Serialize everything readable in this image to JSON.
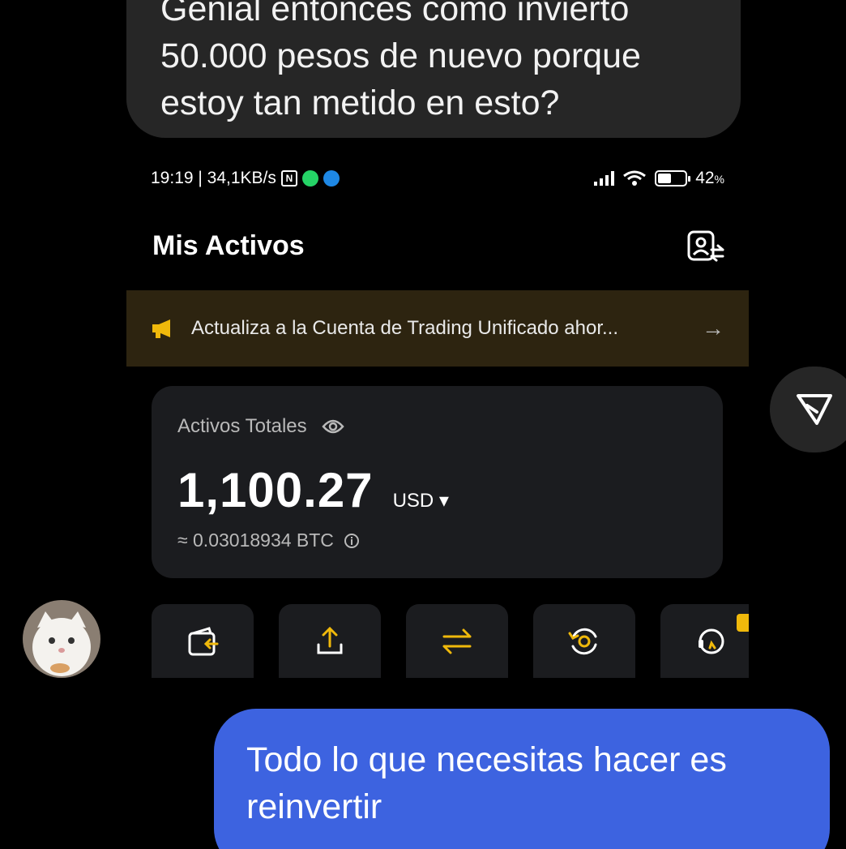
{
  "chat": {
    "incoming_lines": [
      "Genial entonces como invierto",
      "50.000 pesos de nuevo porque",
      "estoy tan metido en esto?"
    ],
    "outgoing_lines": [
      "Todo lo que necesitas hacer es",
      "reinvertir"
    ]
  },
  "screenshot": {
    "status": {
      "time_speed": "19:19 | 34,1KB/s",
      "battery": "42",
      "battery_unit": "%"
    },
    "title": "Mis Activos",
    "banner": {
      "text": "Actualiza a la Cuenta de Trading Unificado ahor...",
      "arrow": "→"
    },
    "total_assets": {
      "label": "Activos Totales",
      "amount": "1,100.27",
      "currency": "USD ▾",
      "btc_equiv": "≈ 0.03018934 BTC"
    },
    "actions": [
      {
        "icon": "deposit-icon"
      },
      {
        "icon": "withdraw-icon"
      },
      {
        "icon": "transfer-icon"
      },
      {
        "icon": "convert-icon"
      },
      {
        "icon": "support-icon"
      }
    ]
  },
  "colors": {
    "background": "#000000",
    "incoming_bubble": "#262626",
    "outgoing_bubble": "#3d63e0",
    "banner_bg": "#2d2410",
    "accent_yellow": "#f0b90b",
    "card_bg": "#1b1c1f"
  }
}
